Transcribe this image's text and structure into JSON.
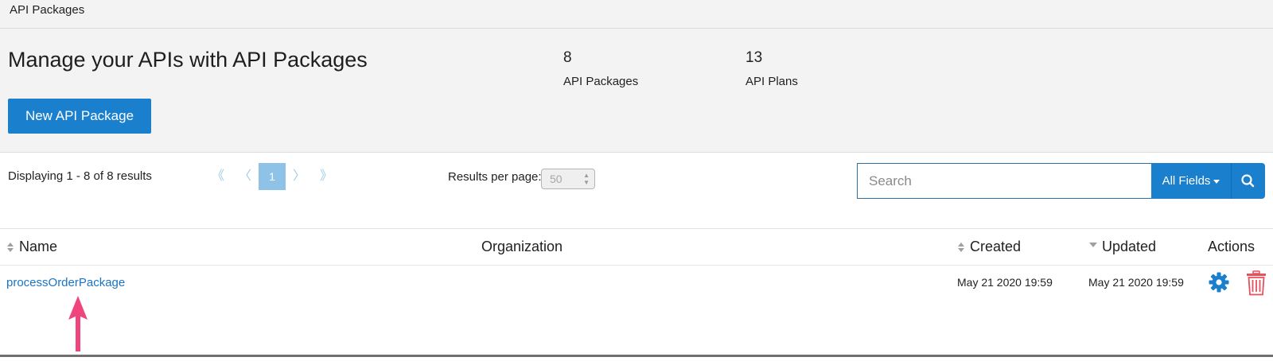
{
  "breadcrumb": "API Packages",
  "header": {
    "title": "Manage your APIs with API Packages",
    "stats": [
      {
        "value": "8",
        "label": "API Packages"
      },
      {
        "value": "13",
        "label": "API Plans"
      }
    ],
    "new_button": "New API Package"
  },
  "toolbar": {
    "results_text": "Displaying 1 - 8 of 8 results",
    "pager": {
      "first": "《",
      "prev": "〈",
      "current": "1",
      "next": "〉",
      "last": "》"
    },
    "per_page_label": "Results per page:",
    "per_page_value": "50",
    "search_placeholder": "Search",
    "fields_button": "All Fields"
  },
  "table": {
    "columns": {
      "name": "Name",
      "organization": "Organization",
      "created": "Created",
      "updated": "Updated",
      "actions": "Actions"
    },
    "rows": [
      {
        "name": "processOrderPackage",
        "organization": "",
        "created": "May 21 2020 19:59",
        "updated": "May 21 2020 19:59"
      }
    ]
  },
  "colors": {
    "accent": "#1a7fcd",
    "link": "#1a74c4",
    "delete": "#e8505b",
    "annotation_arrow": "#f0457c"
  },
  "icons": [
    "gear-icon",
    "trash-icon",
    "search-icon",
    "sort-icon",
    "sort-desc-icon",
    "arrow-annotation"
  ]
}
